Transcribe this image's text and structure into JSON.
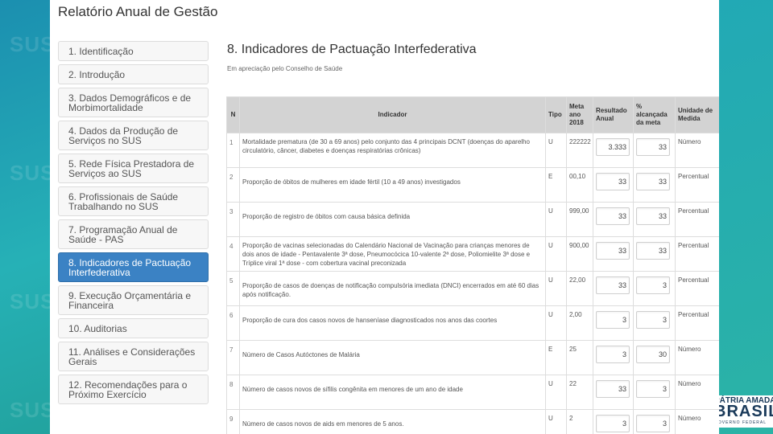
{
  "app_title": "Relatório Anual de Gestão",
  "sidebar": {
    "items": [
      {
        "label": "1. Identificação"
      },
      {
        "label": "2. Introdução"
      },
      {
        "label": "3. Dados Demográficos e de Morbimortalidade"
      },
      {
        "label": "4. Dados da Produção de Serviços no SUS"
      },
      {
        "label": "5. Rede Física Prestadora de Serviços ao SUS"
      },
      {
        "label": "6. Profissionais de Saúde Trabalhando no SUS"
      },
      {
        "label": "7. Programação Anual de Saúde - PAS"
      },
      {
        "label": "8. Indicadores de Pactuação Interfederativa"
      },
      {
        "label": "9. Execução Orçamentária e Financeira"
      },
      {
        "label": "10. Auditorias"
      },
      {
        "label": "11. Análises e Considerações Gerais"
      },
      {
        "label": "12. Recomendações para o Próximo Exercício"
      }
    ],
    "active_index": 7
  },
  "section_title": "8. Indicadores de Pactuação Interfederativa",
  "subtitle": "Em apreciação pelo Conselho de Saúde",
  "table": {
    "headers": {
      "n": "N",
      "indicador": "Indicador",
      "tipo": "Tipo",
      "meta": "Meta ano 2018",
      "resultado": "Resultado Anual",
      "alcancada": "% alcançada da meta",
      "unidade": "Unidade de Medida"
    },
    "rows": [
      {
        "n": "1",
        "indicador": "Mortalidade prematura (de 30 a 69 anos) pelo conjunto das 4 principais DCNT (doenças do aparelho circulatório, câncer, diabetes e doenças respiratórias crônicas)",
        "tipo": "U",
        "meta": "222222",
        "resultado": "3.333",
        "alcancada": "33",
        "unidade": "Número"
      },
      {
        "n": "2",
        "indicador": "Proporção de óbitos de mulheres em idade fértil (10 a 49 anos) investigados",
        "tipo": "E",
        "meta": "00,10",
        "resultado": "33",
        "alcancada": "33",
        "unidade": "Percentual"
      },
      {
        "n": "3",
        "indicador": "Proporção de registro de óbitos com causa básica definida",
        "tipo": "U",
        "meta": "999,00",
        "resultado": "33",
        "alcancada": "33",
        "unidade": "Percentual"
      },
      {
        "n": "4",
        "indicador": "Proporção de vacinas selecionadas do Calendário Nacional de Vacinação para crianças menores de dois anos de idade - Pentavalente 3ª dose, Pneumocócica 10-valente 2ª dose, Poliomielite 3ª dose e Tríplice viral 1ª dose - com cobertura vacinal preconizada",
        "tipo": "U",
        "meta": "900,00",
        "resultado": "33",
        "alcancada": "33",
        "unidade": "Percentual"
      },
      {
        "n": "5",
        "indicador": "Proporção de casos de doenças de notificação compulsória imediata (DNCI) encerrados em até 60 dias após notificação.",
        "tipo": "U",
        "meta": "22,00",
        "resultado": "33",
        "alcancada": "3",
        "unidade": "Percentual"
      },
      {
        "n": "6",
        "indicador": "Proporção de cura dos casos novos de hanseníase diagnosticados nos anos das coortes",
        "tipo": "U",
        "meta": "2,00",
        "resultado": "3",
        "alcancada": "3",
        "unidade": "Percentual"
      },
      {
        "n": "7",
        "indicador": "Número de Casos Autóctones de Malária",
        "tipo": "E",
        "meta": "25",
        "resultado": "3",
        "alcancada": "30",
        "unidade": "Número"
      },
      {
        "n": "8",
        "indicador": "Número de casos novos de sífilis congênita em menores de um ano de idade",
        "tipo": "U",
        "meta": "22",
        "resultado": "33",
        "alcancada": "3",
        "unidade": "Número"
      },
      {
        "n": "9",
        "indicador": "Número de casos novos de aids em menores de 5 anos.",
        "tipo": "U",
        "meta": "2",
        "resultado": "3",
        "alcancada": "3",
        "unidade": "Número"
      }
    ]
  },
  "background_watermark": "SUS",
  "brand": {
    "line1": "PÁTRIA AMADA",
    "line2": "BRASIL",
    "line3": "GOVERNO FEDERAL"
  },
  "colors": {
    "active_nav": "#3b82c4",
    "table_header": "#d3d3d3",
    "background": "#1fa6b8"
  }
}
